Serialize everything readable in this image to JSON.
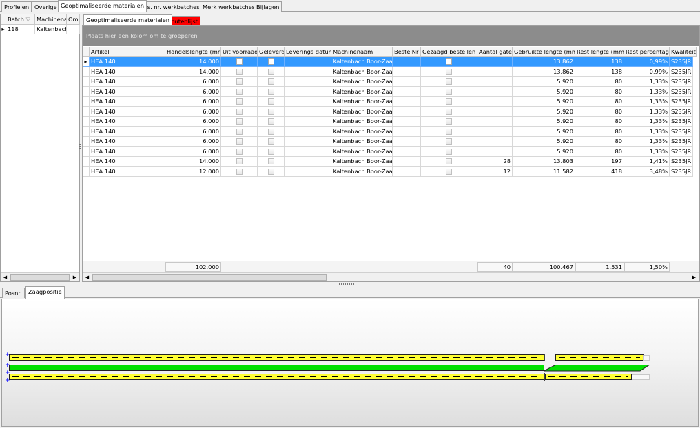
{
  "top_tabs": [
    "Profielen",
    "Overige",
    "Geoptimaliseerde materialen",
    "Pos. nr. werkbatches",
    "Merk werkbatches",
    "Bijlagen"
  ],
  "left_grid": {
    "headers": [
      "Batch",
      "Machinena",
      "Oms"
    ],
    "rows": [
      {
        "batch": "118",
        "machine": "Kaltenbach",
        "oms": ""
      }
    ]
  },
  "inner_tabs": [
    "Geoptimaliseerde materialen",
    "Foutenlijst"
  ],
  "group_hint": "Plaats hier een kolom om te groeperen",
  "columns": [
    "Artikel",
    "Handelslengte (mm)",
    "Uit voorraad",
    "Geleverd",
    "Leverings datum",
    "Machinenaam",
    "BestelNr",
    "Gezaagd bestellen",
    "Aantal gaten",
    "Gebruikte lengte (mm)",
    "Rest lengte (mm)",
    "Rest percentage",
    "Kwaliteit"
  ],
  "rows": [
    {
      "artikel": "HEA 140",
      "handelslengte": "14.000",
      "uit_voorraad": false,
      "geleverd": false,
      "datum": "",
      "machine": "Kaltenbach Boor-Zaag",
      "bestelnr": "",
      "gezaagd": false,
      "gaten": "",
      "gebruikt": "13.862",
      "rest": "138",
      "perc": "0,99%",
      "kwaliteit": "S235JR"
    },
    {
      "artikel": "HEA 140",
      "handelslengte": "14.000",
      "uit_voorraad": false,
      "geleverd": false,
      "datum": "",
      "machine": "Kaltenbach Boor-Zaag",
      "bestelnr": "",
      "gezaagd": false,
      "gaten": "",
      "gebruikt": "13.862",
      "rest": "138",
      "perc": "0,99%",
      "kwaliteit": "S235JR"
    },
    {
      "artikel": "HEA 140",
      "handelslengte": "6.000",
      "uit_voorraad": false,
      "geleverd": false,
      "datum": "",
      "machine": "Kaltenbach Boor-Zaag",
      "bestelnr": "",
      "gezaagd": false,
      "gaten": "",
      "gebruikt": "5.920",
      "rest": "80",
      "perc": "1,33%",
      "kwaliteit": "S235JR"
    },
    {
      "artikel": "HEA 140",
      "handelslengte": "6.000",
      "uit_voorraad": false,
      "geleverd": false,
      "datum": "",
      "machine": "Kaltenbach Boor-Zaag",
      "bestelnr": "",
      "gezaagd": false,
      "gaten": "",
      "gebruikt": "5.920",
      "rest": "80",
      "perc": "1,33%",
      "kwaliteit": "S235JR"
    },
    {
      "artikel": "HEA 140",
      "handelslengte": "6.000",
      "uit_voorraad": false,
      "geleverd": false,
      "datum": "",
      "machine": "Kaltenbach Boor-Zaag",
      "bestelnr": "",
      "gezaagd": false,
      "gaten": "",
      "gebruikt": "5.920",
      "rest": "80",
      "perc": "1,33%",
      "kwaliteit": "S235JR"
    },
    {
      "artikel": "HEA 140",
      "handelslengte": "6.000",
      "uit_voorraad": false,
      "geleverd": false,
      "datum": "",
      "machine": "Kaltenbach Boor-Zaag",
      "bestelnr": "",
      "gezaagd": false,
      "gaten": "",
      "gebruikt": "5.920",
      "rest": "80",
      "perc": "1,33%",
      "kwaliteit": "S235JR"
    },
    {
      "artikel": "HEA 140",
      "handelslengte": "6.000",
      "uit_voorraad": false,
      "geleverd": false,
      "datum": "",
      "machine": "Kaltenbach Boor-Zaag",
      "bestelnr": "",
      "gezaagd": false,
      "gaten": "",
      "gebruikt": "5.920",
      "rest": "80",
      "perc": "1,33%",
      "kwaliteit": "S235JR"
    },
    {
      "artikel": "HEA 140",
      "handelslengte": "6.000",
      "uit_voorraad": false,
      "geleverd": false,
      "datum": "",
      "machine": "Kaltenbach Boor-Zaag",
      "bestelnr": "",
      "gezaagd": false,
      "gaten": "",
      "gebruikt": "5.920",
      "rest": "80",
      "perc": "1,33%",
      "kwaliteit": "S235JR"
    },
    {
      "artikel": "HEA 140",
      "handelslengte": "6.000",
      "uit_voorraad": false,
      "geleverd": false,
      "datum": "",
      "machine": "Kaltenbach Boor-Zaag",
      "bestelnr": "",
      "gezaagd": false,
      "gaten": "",
      "gebruikt": "5.920",
      "rest": "80",
      "perc": "1,33%",
      "kwaliteit": "S235JR"
    },
    {
      "artikel": "HEA 140",
      "handelslengte": "6.000",
      "uit_voorraad": false,
      "geleverd": false,
      "datum": "",
      "machine": "Kaltenbach Boor-Zaag",
      "bestelnr": "",
      "gezaagd": false,
      "gaten": "",
      "gebruikt": "5.920",
      "rest": "80",
      "perc": "1,33%",
      "kwaliteit": "S235JR"
    },
    {
      "artikel": "HEA 140",
      "handelslengte": "14.000",
      "uit_voorraad": false,
      "geleverd": false,
      "datum": "",
      "machine": "Kaltenbach Boor-Zaag",
      "bestelnr": "",
      "gezaagd": false,
      "gaten": "28",
      "gebruikt": "13.803",
      "rest": "197",
      "perc": "1,41%",
      "kwaliteit": "S235JR"
    },
    {
      "artikel": "HEA 140",
      "handelslengte": "12.000",
      "uit_voorraad": false,
      "geleverd": false,
      "datum": "",
      "machine": "Kaltenbach Boor-Zaag",
      "bestelnr": "",
      "gezaagd": false,
      "gaten": "12",
      "gebruikt": "11.582",
      "rest": "418",
      "perc": "3,48%",
      "kwaliteit": "S235JR"
    }
  ],
  "selected_row": 0,
  "totals": {
    "handelslengte": "102.000",
    "gaten": "40",
    "gebruikt": "100.467",
    "rest": "1.531",
    "perc": "1,50%"
  },
  "bottom_tabs": [
    "Posnr.",
    "Zaagpositie"
  ],
  "colors": {
    "selection": "#3399ff",
    "error_tab": "#ff0000",
    "bar_yellow": "#ffff33",
    "bar_green": "#00e000",
    "plus_marker": "#2020ff"
  },
  "icons": {
    "row_indicator": "triangle-right-icon",
    "sort_indicator": "sort-icon",
    "scroll_left": "arrow-left-icon",
    "scroll_right": "arrow-right-icon"
  }
}
